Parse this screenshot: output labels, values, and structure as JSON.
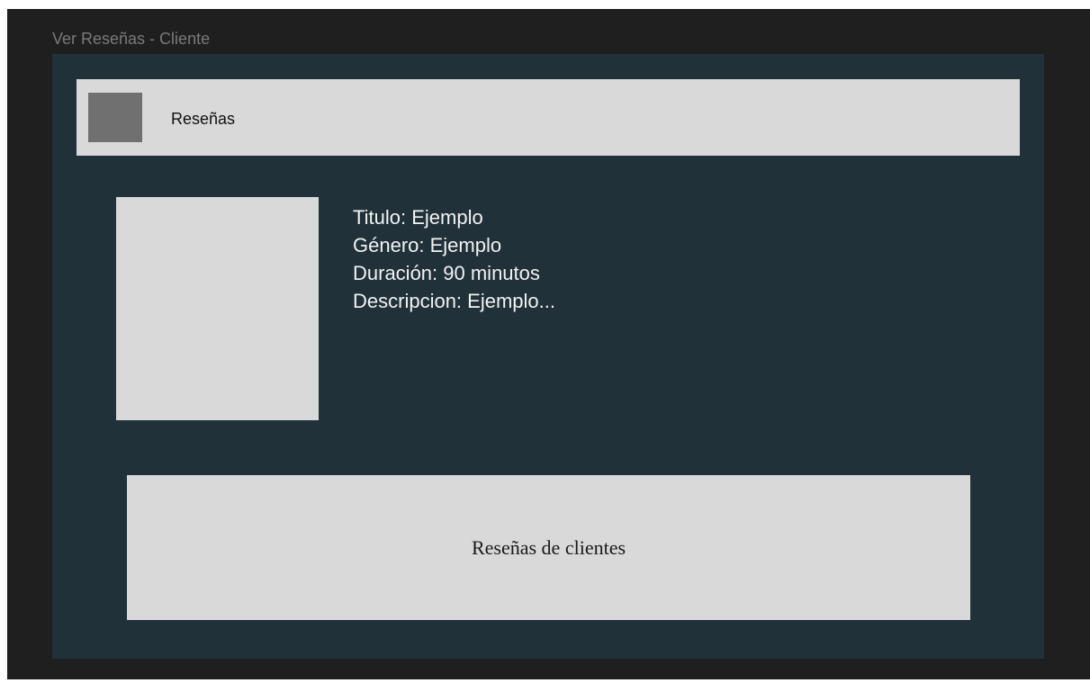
{
  "frame": {
    "label": "Ver Reseñas - Cliente"
  },
  "header": {
    "title": "Reseñas"
  },
  "movie": {
    "title_line": "Titulo: Ejemplo",
    "genre_line": "Género: Ejemplo",
    "duration_line": "Duración: 90 minutos",
    "description_line": "Descripcion: Ejemplo..."
  },
  "reviews": {
    "label": "Reseñas de clientes"
  }
}
